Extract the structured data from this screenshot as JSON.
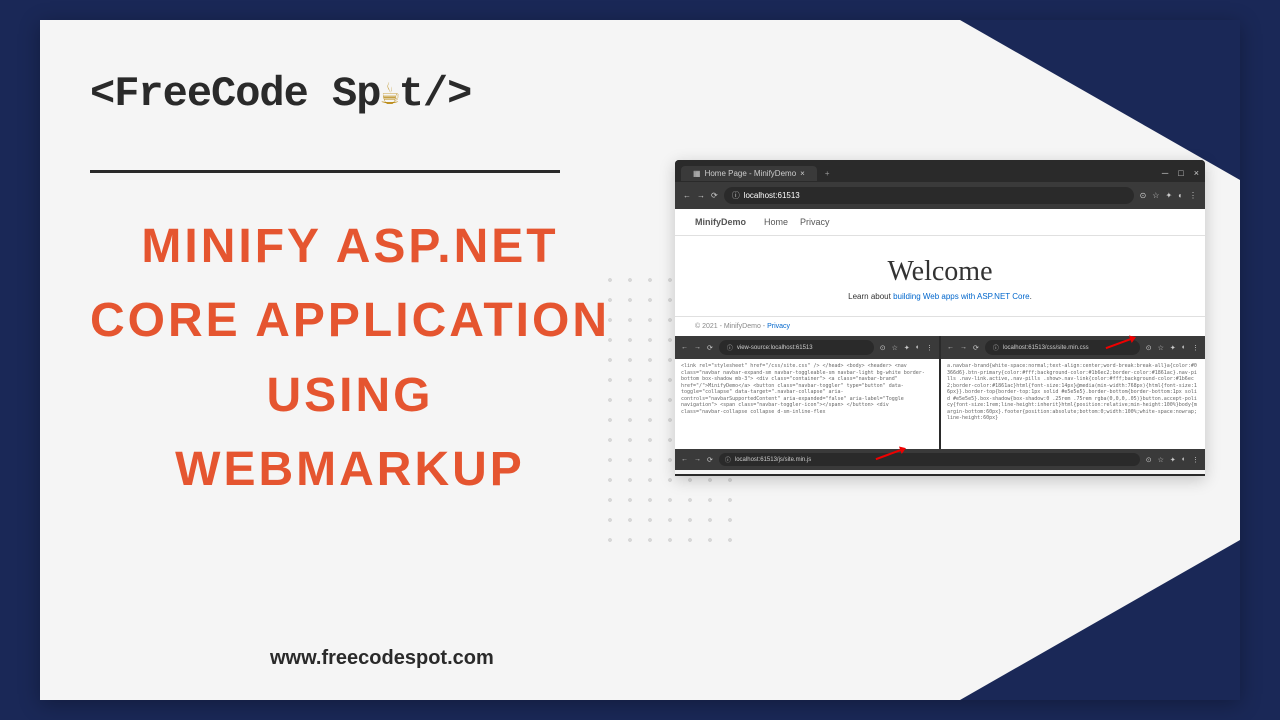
{
  "logo": {
    "text_before": "<FreeCode Sp",
    "cup": "☕",
    "text_after": "t/>"
  },
  "title": "MINIFY ASP.NET CORE APPLICATION USING WEBMARKUP",
  "footer_url": "www.freecodespot.com",
  "browser": {
    "tab_title": "Home Page - MinifyDemo",
    "url": "localhost:61513",
    "url_prefix": "ⓘ",
    "plus": "+",
    "nav": {
      "brand": "MinifyDemo",
      "links": [
        "Home",
        "Privacy"
      ]
    },
    "welcome": {
      "heading": "Welcome",
      "text_before": "Learn about ",
      "link": "building Web apps with ASP.NET Core",
      "text_after": "."
    },
    "footer": {
      "copyright": "© 2021 - MinifyDemo - ",
      "privacy": "Privacy"
    }
  },
  "panel_left": {
    "url": "view-source:localhost:61513",
    "code": "<link rel=\"stylesheet\" href=\"/css/site.css\" />\n</head>\n<body>\n  <header>\n    <nav class=\"navbar navbar-expand-sm navbar-toggleable-sm navbar-light bg-white border-bottom box-shadow mb-3\">\n      <div class=\"container\">\n        <a class=\"navbar-brand\" href=\"/\">MinifyDemo</a>\n        <button class=\"navbar-toggler\" type=\"button\" data-toggle=\"collapse\" data-target=\".navbar-collapse\" aria-controls=\"navbarSupportedContent\"\n          aria-expanded=\"false\" aria-label=\"Toggle navigation\">\n          <span class=\"navbar-toggler-icon\"></span>\n        </button>\n        <div class=\"navbar-collapse collapse d-sm-inline-flex"
  },
  "panel_right": {
    "url": "localhost:61513/css/site.min.css",
    "code": "a.navbar-brand{white-space:normal;text-align:center;word-break:break-all}a{color:#0366d6}.btn-primary{color:#fff;background-color:#1b6ec2;border-color:#1861ac}.nav-pills .nav-link.active,.nav-pills .show>.nav-link{color:#fff;background-color:#1b6ec2;border-color:#1861ac}html{font-size:14px}@media(min-width:768px){html{font-size:16px}}.border-top{border-top:1px solid #e5e5e5}.border-bottom{border-bottom:1px solid #e5e5e5}.box-shadow{box-shadow:0 .25rem .75rem rgba(0,0,0,.05)}button.accept-policy{font-size:1rem;line-height:inherit}html{position:relative;min-height:100%}body{margin-bottom:60px}.footer{position:absolute;bottom:0;width:100%;white-space:nowrap;line-height:60px}"
  },
  "bottom_bar": {
    "url": "localhost:61513/js/site.min.js"
  }
}
